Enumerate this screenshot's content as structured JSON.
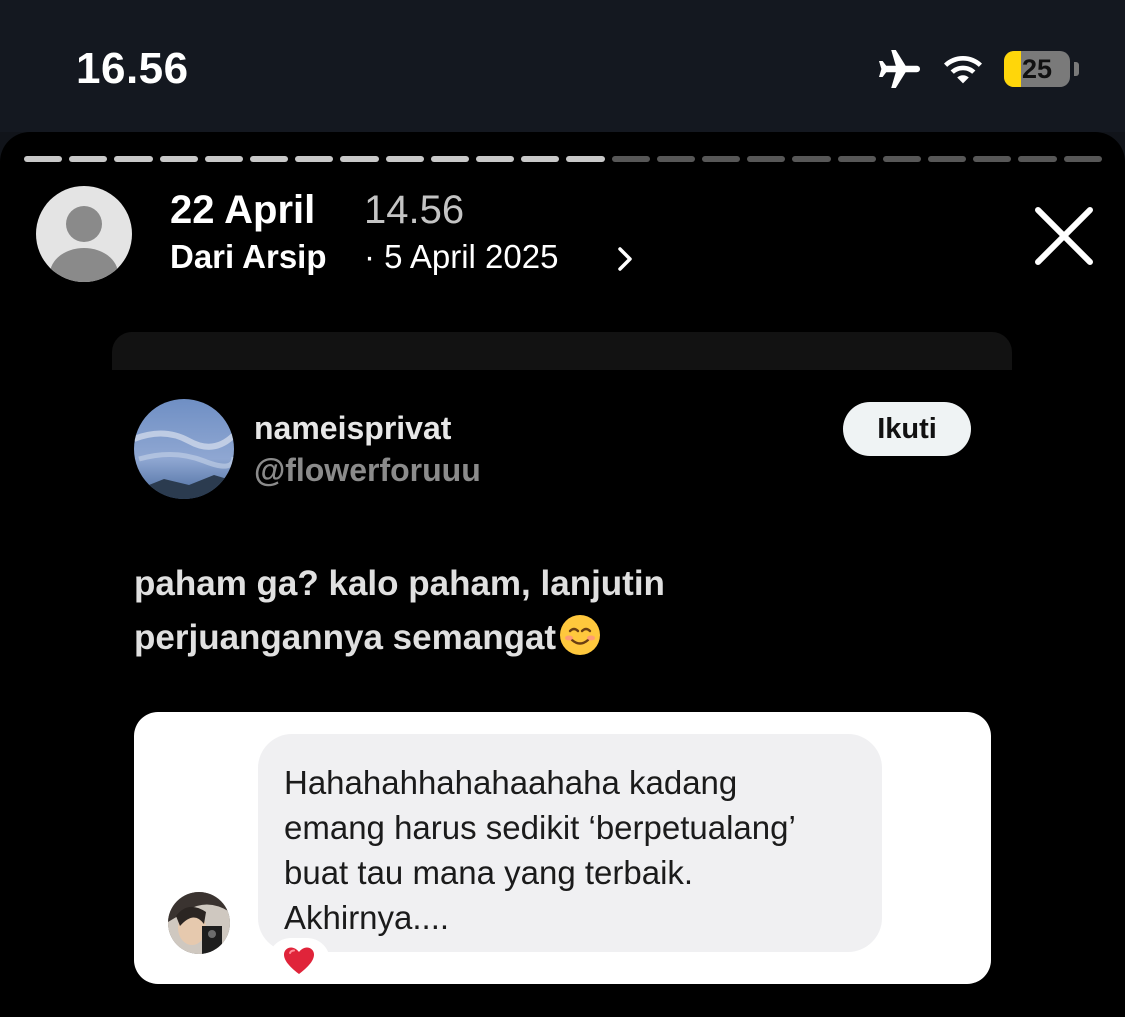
{
  "status_bar": {
    "time": "16.56",
    "battery_level": "25",
    "battery_fraction": 0.25,
    "icons": [
      "airplane-icon",
      "wifi-icon",
      "battery-icon"
    ]
  },
  "story": {
    "progress_segments": 24,
    "progress_completed": 13,
    "header": {
      "date": "22 April",
      "time": "14.56",
      "archive_label": "Dari Arsip",
      "archive_date": "· 5 April 2025"
    },
    "close_icon": "close-icon"
  },
  "screenshot": {
    "tweet": {
      "display_name": "nameisprivat",
      "handle": "@flowerforuuu",
      "follow_label": "Ikuti",
      "text_line1": "paham ga? kalo paham, lanjutin",
      "text_line2": "perjuangannya semangat"
    },
    "chat": {
      "line1": "Hahahahhahahaahaha kadang",
      "line2": "emang harus sedikit ‘berpetualang’",
      "line3": "buat tau mana yang terbaik.",
      "line4": "Akhirnya....",
      "reaction": "heart-icon"
    }
  },
  "colors": {
    "status_bg": "#141820",
    "story_bg": "#000000",
    "battery_yellow": "#ffd60a",
    "follow_bg": "#eff3f4",
    "bubble_bg": "#f0f0f2"
  }
}
